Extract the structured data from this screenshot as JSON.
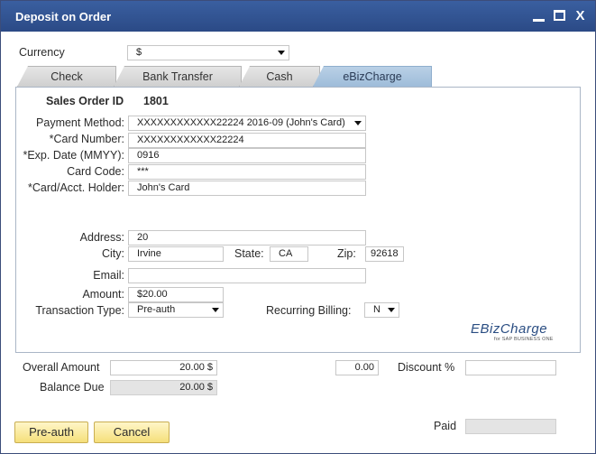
{
  "window": {
    "title": "Deposit on Order",
    "controls": {
      "minimize": "minimize-icon",
      "maximize": "maximize-icon",
      "close": "X"
    }
  },
  "currency": {
    "label": "Currency",
    "value": "$"
  },
  "tabs": [
    {
      "label": "Check",
      "active": false
    },
    {
      "label": "Bank Transfer",
      "active": false
    },
    {
      "label": "Cash",
      "active": false
    },
    {
      "label": "eBizCharge",
      "active": true
    }
  ],
  "form": {
    "sales_order": {
      "label": "Sales Order ID",
      "value": "1801"
    },
    "payment_method": {
      "label": "Payment Method:",
      "value": "XXXXXXXXXXXX22224 2016-09 (John's Card)"
    },
    "card_number": {
      "label": "*Card Number:",
      "value": "XXXXXXXXXXXX22224"
    },
    "exp_date": {
      "label": "*Exp. Date (MMYY):",
      "value": "0916"
    },
    "card_code": {
      "label": "Card Code:",
      "value": "***"
    },
    "holder": {
      "label": "*Card/Acct. Holder:",
      "value": "John's Card"
    },
    "address": {
      "label": "Address:",
      "value": "20"
    },
    "city": {
      "label": "City:",
      "value": "Irvine"
    },
    "state": {
      "label": "State:",
      "value": "CA"
    },
    "zip": {
      "label": "Zip:",
      "value": "92618"
    },
    "email": {
      "label": "Email:",
      "value": ""
    },
    "amount": {
      "label": "Amount:",
      "value": "$20.00"
    },
    "transaction_type": {
      "label": "Transaction Type:",
      "value": "Pre-auth"
    },
    "recurring_billing": {
      "label": "Recurring Billing:",
      "value": "N"
    }
  },
  "logo": {
    "main": "EBizCharge",
    "sub": "for SAP BUSINESS ONE"
  },
  "totals": {
    "overall_amount": {
      "label": "Overall Amount",
      "value": "20.00 $"
    },
    "discount_value": "0.00",
    "discount": {
      "label": "Discount %",
      "value": ""
    },
    "balance_due": {
      "label": "Balance Due",
      "value": "20.00 $"
    },
    "paid": {
      "label": "Paid",
      "value": ""
    }
  },
  "buttons": {
    "preauth": "Pre-auth",
    "cancel": "Cancel"
  },
  "colors": {
    "titlebar": "#2b4a86",
    "active_tab": "#a9c4df",
    "button": "#f5df7a"
  }
}
